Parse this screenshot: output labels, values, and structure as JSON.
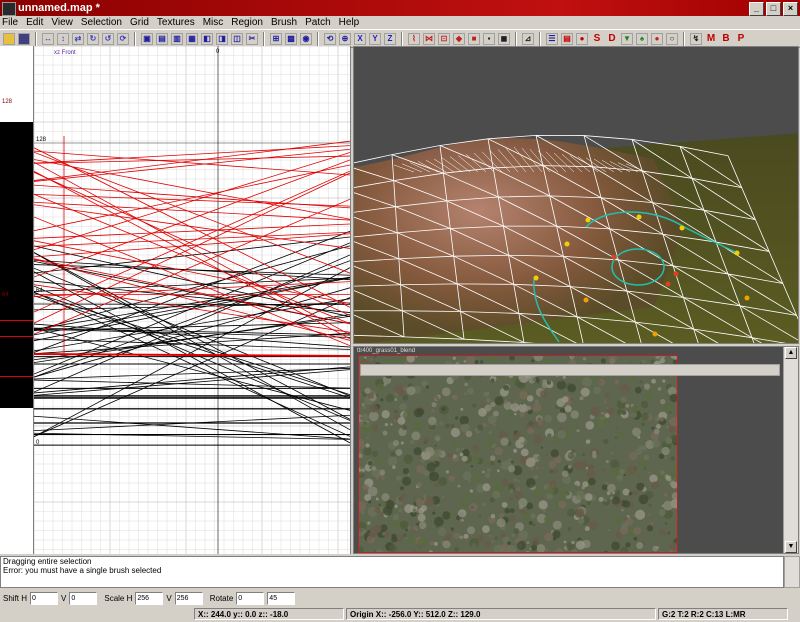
{
  "window": {
    "title": "unnamed.map *",
    "controls": [
      "_",
      "□",
      "×"
    ]
  },
  "menu": [
    "File",
    "Edit",
    "View",
    "Selection",
    "Grid",
    "Textures",
    "Misc",
    "Region",
    "Brush",
    "Patch",
    "Help"
  ],
  "toolbar": {
    "letters": [
      "X",
      "Y",
      "Z"
    ],
    "red_buttons": [
      "S",
      "D",
      "M",
      "B",
      "P"
    ]
  },
  "xy_view": {
    "corner_label": "xz Front",
    "top_tick": "0",
    "labels": [
      "128",
      "64",
      "0"
    ],
    "strip_labels": [
      "128",
      "64"
    ]
  },
  "texture_browser": {
    "texture_name": "ttr400_grass01_blend"
  },
  "console": {
    "lines": [
      "Dragging entire selection",
      "Error: you must have a single brush selected"
    ]
  },
  "surface": {
    "shift_h_label": "Shift H",
    "shift_h": "0",
    "shift_v_label": "V",
    "shift_v": "0",
    "scale_h_label": "Scale H",
    "scale_h": "256",
    "scale_v_label": "V",
    "scale_v": "256",
    "rotate_label": "Rotate",
    "rotate": "0",
    "rotate_step": "45"
  },
  "status": {
    "coords": "X:: 244.0  y:: 0.0  z:: -18.0",
    "origin": "Origin X:: -256.0  Y:: 512.0  Z:: 129.0",
    "grid": "G:2 T:2 R:2 C:13 L:MR"
  },
  "colors": {
    "titlebar": "#c01010",
    "selection_red": "#e00000",
    "camera_bg": "#4c4c4c",
    "curve": "#20c0c0",
    "control_point": "#f0d000"
  }
}
